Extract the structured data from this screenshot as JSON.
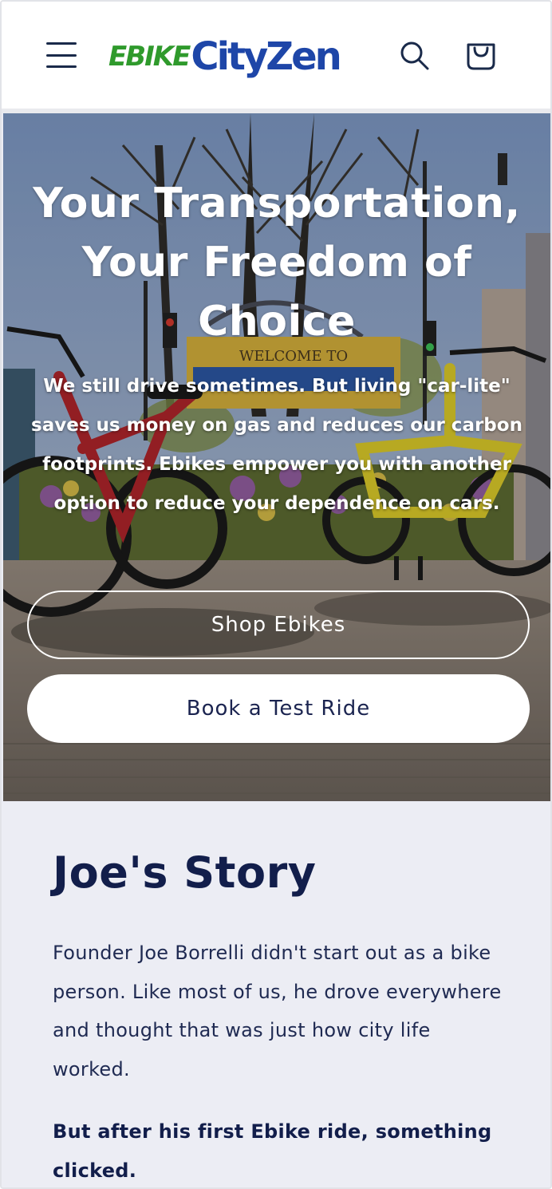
{
  "header": {
    "menu_icon": "hamburger-menu-icon",
    "logo_part1": "EBIKE",
    "logo_part2": "CityZen",
    "search_icon": "search-icon",
    "cart_icon": "shopping-bag-icon",
    "brand_green": "#2f9a2c",
    "brand_blue": "#1e46a8"
  },
  "hero": {
    "title": "Your Transportation, Your Freedom of Choice",
    "text": "We still drive sometimes. But living \"car-lite\" saves us money on gas and reduces our carbon footprints. Ebikes empower you with another option to reduce your dependence on cars.",
    "sign_text": "WELCOME TO",
    "primary_button": "Shop Ebikes",
    "secondary_button": "Book a Test Ride"
  },
  "story": {
    "title": "Joe's Story",
    "paragraph": "Founder Joe Borrelli didn't start out as a bike person. Like most of us, he drove everywhere and thought that was just how city life worked.",
    "bold_paragraph": "But after his first Ebike ride, something clicked."
  }
}
